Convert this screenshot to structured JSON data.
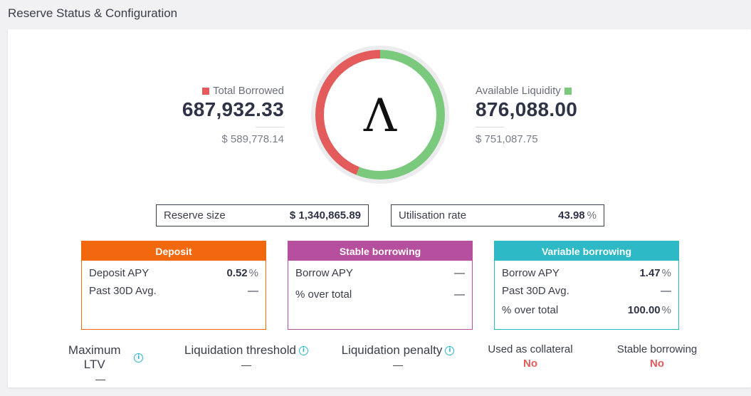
{
  "header": {
    "title": "Reserve Status & Configuration"
  },
  "colors": {
    "borrowed": "#e35b5b",
    "liquidity": "#7bc97d",
    "deposit": "#f2680f",
    "stable": "#b64f9d",
    "variable": "#2db9c6"
  },
  "chart_data": {
    "type": "pie",
    "labels": [
      "Total Borrowed",
      "Available Liquidity"
    ],
    "values": [
      687932.33,
      876088.0
    ],
    "center_glyph": "Λ"
  },
  "total_borrowed": {
    "label": "Total Borrowed",
    "value": "687,932.33",
    "usd": "$ 589,778.14"
  },
  "available_liquidity": {
    "label": "Available Liquidity",
    "value": "876,088.00",
    "usd": "$ 751,087.75"
  },
  "reserve_size": {
    "label": "Reserve size",
    "value": "$ 1,340,865.89"
  },
  "utilisation": {
    "label": "Utilisation rate",
    "value": "43.98",
    "unit": "%"
  },
  "deposit": {
    "title": "Deposit",
    "rows": [
      {
        "label": "Deposit APY",
        "value": "0.52",
        "unit": "%"
      },
      {
        "label": "Past 30D Avg.",
        "value": "—",
        "unit": ""
      }
    ]
  },
  "stable": {
    "title": "Stable borrowing",
    "rows": [
      {
        "label": "Borrow APY",
        "value": "—",
        "unit": ""
      },
      {
        "label": "% over total",
        "value": "—",
        "unit": ""
      }
    ]
  },
  "variable": {
    "title": "Variable borrowing",
    "rows": [
      {
        "label": "Borrow APY",
        "value": "1.47",
        "unit": "%"
      },
      {
        "label": "Past 30D Avg.",
        "value": "—",
        "unit": ""
      },
      {
        "label": "% over total",
        "value": "100.00",
        "unit": "%"
      }
    ]
  },
  "params": {
    "max_ltv": {
      "label": "Maximum LTV",
      "value": "—"
    },
    "liq_threshold": {
      "label": "Liquidation threshold",
      "value": "—"
    },
    "liq_penalty": {
      "label": "Liquidation penalty",
      "value": "—"
    },
    "collateral": {
      "label": "Used as collateral",
      "value": "No"
    },
    "stable_borrowing": {
      "label": "Stable borrowing",
      "value": "No"
    }
  },
  "icons": {
    "info": "info-icon",
    "token": "aave-logo-icon"
  }
}
